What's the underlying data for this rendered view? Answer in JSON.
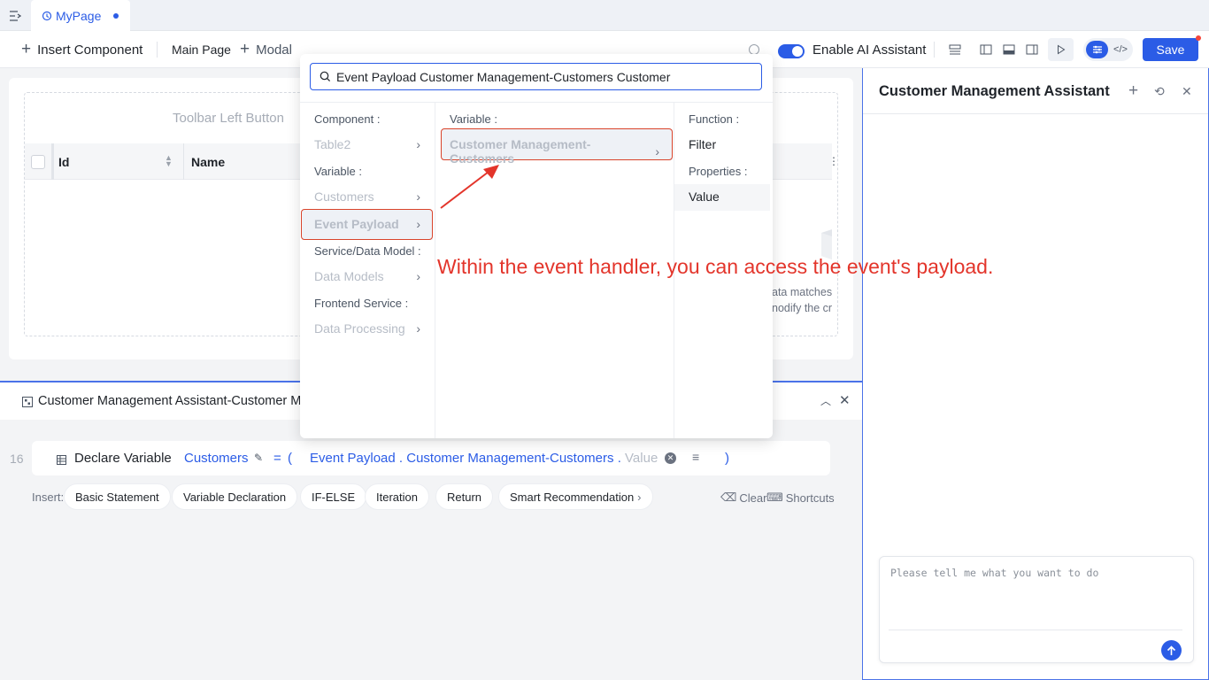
{
  "tabbar": {
    "page_tab": "MyPage"
  },
  "toolbar": {
    "insert_component": "Insert Component",
    "main_page": "Main Page",
    "modal": "Modal",
    "ai_toggle_label": "Enable AI Assistant",
    "save": "Save"
  },
  "canvas": {
    "toolbar_left_button": "Toolbar Left Button",
    "columns": [
      "Id",
      "Name"
    ],
    "empty_text_line1": "ata matches",
    "empty_text_line2": "nodify the cr"
  },
  "bottom_panel": {
    "title": "Customer Management Assistant-Customer M",
    "line_number": "16",
    "statement": "Declare Variable",
    "variable": "Customers",
    "equals": "=",
    "open_paren": "(",
    "close_paren": ")",
    "expr_part1": "Event Payload",
    "expr_dot1": ".",
    "expr_part2": "Customer Management-Customers",
    "expr_dot2": ".",
    "expr_placeholder": "Value",
    "insert_label": "Insert:",
    "insert_chips": [
      "Basic Statement",
      "Variable Declaration",
      "IF-ELSE",
      "Iteration",
      "Return",
      "Smart Recommendation"
    ],
    "clear": "Clear",
    "shortcuts": "Shortcuts"
  },
  "popup": {
    "search_value": "Event Payload Customer Management-Customers Customer",
    "col1": {
      "component_label": "Component :",
      "table2": "Table2",
      "variable_label": "Variable :",
      "customers": "Customers",
      "event_payload": "Event Payload",
      "service_label": "Service/Data Model :",
      "data_models": "Data Models",
      "frontend_label": "Frontend Service :",
      "data_processing": "Data Processing"
    },
    "col2": {
      "variable_label": "Variable :",
      "customer_mgmt": "Customer Management-Customers"
    },
    "col3": {
      "function_label": "Function :",
      "filter": "Filter",
      "properties_label": "Properties :",
      "value": "Value"
    }
  },
  "annotation": "Within the event handler, you can access the event's payload.",
  "assistant": {
    "title": "Customer Management Assistant",
    "input_placeholder": "Please tell me what you want to do"
  },
  "colors": {
    "accent": "#2b5ce6",
    "annotation": "#e3352b"
  }
}
